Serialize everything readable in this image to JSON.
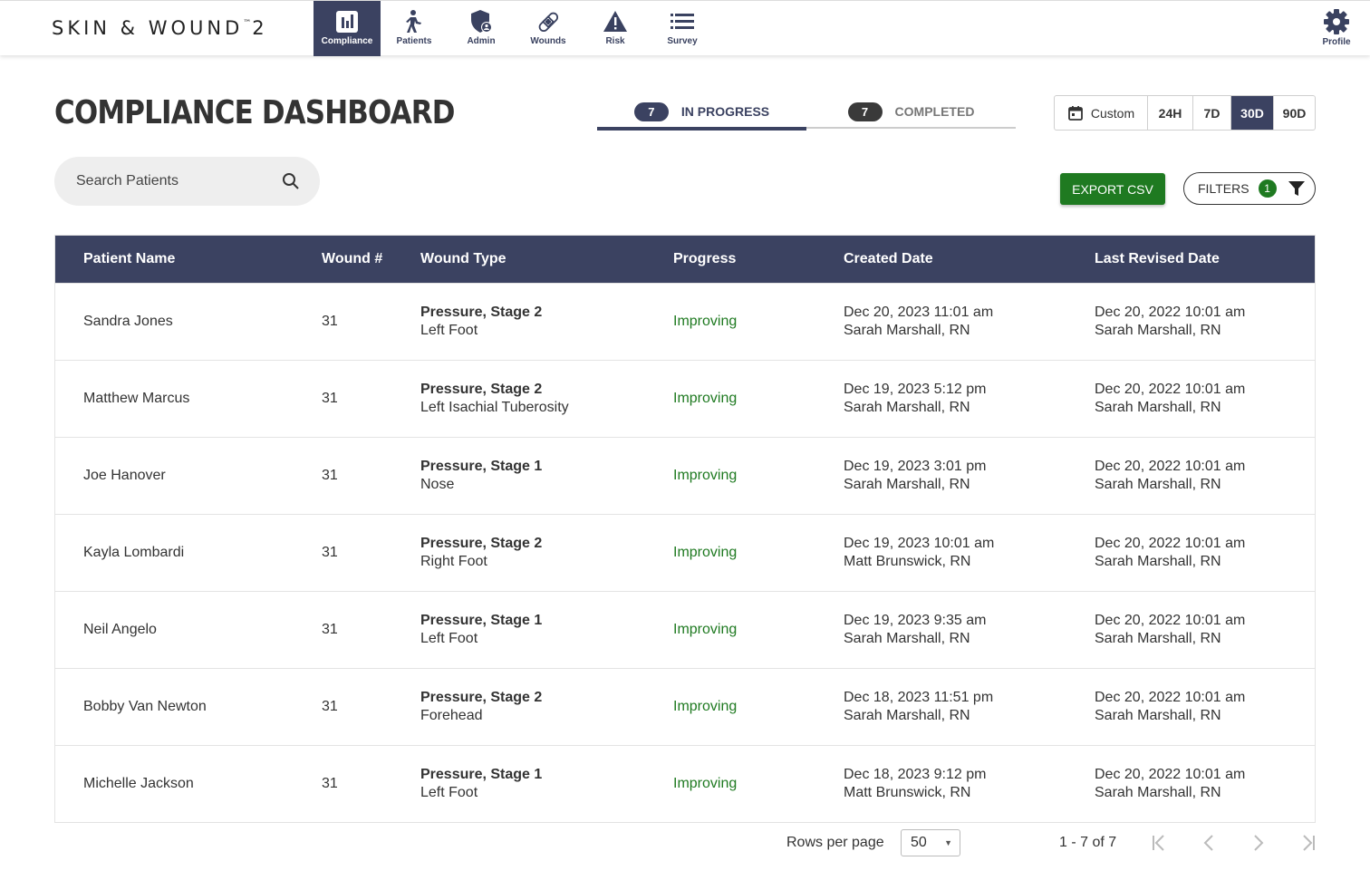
{
  "app": {
    "logo_main": "SKIN & WOUND",
    "logo_sup": "™",
    "logo_num": "2"
  },
  "nav": {
    "items": [
      {
        "label": "Compliance",
        "icon": "bar-chart-icon",
        "active": true
      },
      {
        "label": "Patients",
        "icon": "person-walking-icon",
        "active": false
      },
      {
        "label": "Admin",
        "icon": "shield-user-icon",
        "active": false
      },
      {
        "label": "Wounds",
        "icon": "bandage-icon",
        "active": false
      },
      {
        "label": "Risk",
        "icon": "warning-icon",
        "active": false
      },
      {
        "label": "Survey",
        "icon": "list-icon",
        "active": false
      }
    ],
    "profile_label": "Profile"
  },
  "page": {
    "title": "COMPLIANCE DASHBOARD"
  },
  "status_tabs": [
    {
      "count": "7",
      "label": "IN PROGRESS",
      "active": true
    },
    {
      "count": "7",
      "label": "COMPLETED",
      "active": false
    }
  ],
  "date_range": {
    "custom_label": "Custom",
    "options": [
      "24H",
      "7D",
      "30D",
      "90D"
    ],
    "selected": "30D"
  },
  "search": {
    "placeholder": "Search Patients",
    "value": ""
  },
  "actions": {
    "export_label": "EXPORT CSV",
    "filters_label": "FILTERS",
    "filters_count": "1"
  },
  "table": {
    "headers": [
      "Patient Name",
      "Wound #",
      "Wound Type",
      "Progress",
      "Created Date",
      "Last Revised Date"
    ],
    "rows": [
      {
        "name": "Sandra Jones",
        "wound": "31",
        "type": "Pressure, Stage 2",
        "location": "Left Foot",
        "progress": "Improving",
        "created_date": "Dec 20, 2023 11:01 am",
        "created_by": "Sarah Marshall, RN",
        "revised_date": "Dec 20, 2022 10:01 am",
        "revised_by": "Sarah Marshall, RN"
      },
      {
        "name": "Matthew Marcus",
        "wound": "31",
        "type": "Pressure, Stage 2",
        "location": "Left Isachial Tuberosity",
        "progress": "Improving",
        "created_date": "Dec 19, 2023 5:12 pm",
        "created_by": "Sarah Marshall, RN",
        "revised_date": "Dec 20, 2022 10:01 am",
        "revised_by": "Sarah Marshall, RN"
      },
      {
        "name": "Joe Hanover",
        "wound": "31",
        "type": "Pressure, Stage 1",
        "location": "Nose",
        "progress": "Improving",
        "created_date": "Dec 19, 2023 3:01 pm",
        "created_by": "Sarah Marshall, RN",
        "revised_date": "Dec 20, 2022 10:01 am",
        "revised_by": "Sarah Marshall, RN"
      },
      {
        "name": "Kayla Lombardi",
        "wound": "31",
        "type": "Pressure, Stage 2",
        "location": "Right Foot",
        "progress": "Improving",
        "created_date": "Dec 19, 2023 10:01 am",
        "created_by": "Matt Brunswick, RN",
        "revised_date": "Dec 20, 2022 10:01 am",
        "revised_by": "Sarah Marshall, RN"
      },
      {
        "name": "Neil Angelo",
        "wound": "31",
        "type": "Pressure, Stage 1",
        "location": "Left Foot",
        "progress": "Improving",
        "created_date": "Dec 19, 2023 9:35 am",
        "created_by": "Sarah Marshall, RN",
        "revised_date": "Dec 20, 2022 10:01 am",
        "revised_by": "Sarah Marshall, RN"
      },
      {
        "name": "Bobby Van Newton",
        "wound": "31",
        "type": "Pressure, Stage 2",
        "location": "Forehead",
        "progress": "Improving",
        "created_date": "Dec 18, 2023 11:51 pm",
        "created_by": "Sarah Marshall, RN",
        "revised_date": "Dec 20, 2022 10:01 am",
        "revised_by": "Sarah Marshall, RN"
      },
      {
        "name": "Michelle Jackson",
        "wound": "31",
        "type": "Pressure, Stage 1",
        "location": "Left Foot",
        "progress": "Improving",
        "created_date": "Dec 18, 2023 9:12 pm",
        "created_by": "Matt Brunswick, RN",
        "revised_date": "Dec 20, 2022 10:01 am",
        "revised_by": "Sarah Marshall, RN"
      }
    ]
  },
  "pagination": {
    "rows_per_page_label": "Rows per page",
    "rows_per_page": "50",
    "range_text": "1 - 7 of 7"
  },
  "colors": {
    "navy": "#3b4261",
    "green": "#1f7a21"
  }
}
